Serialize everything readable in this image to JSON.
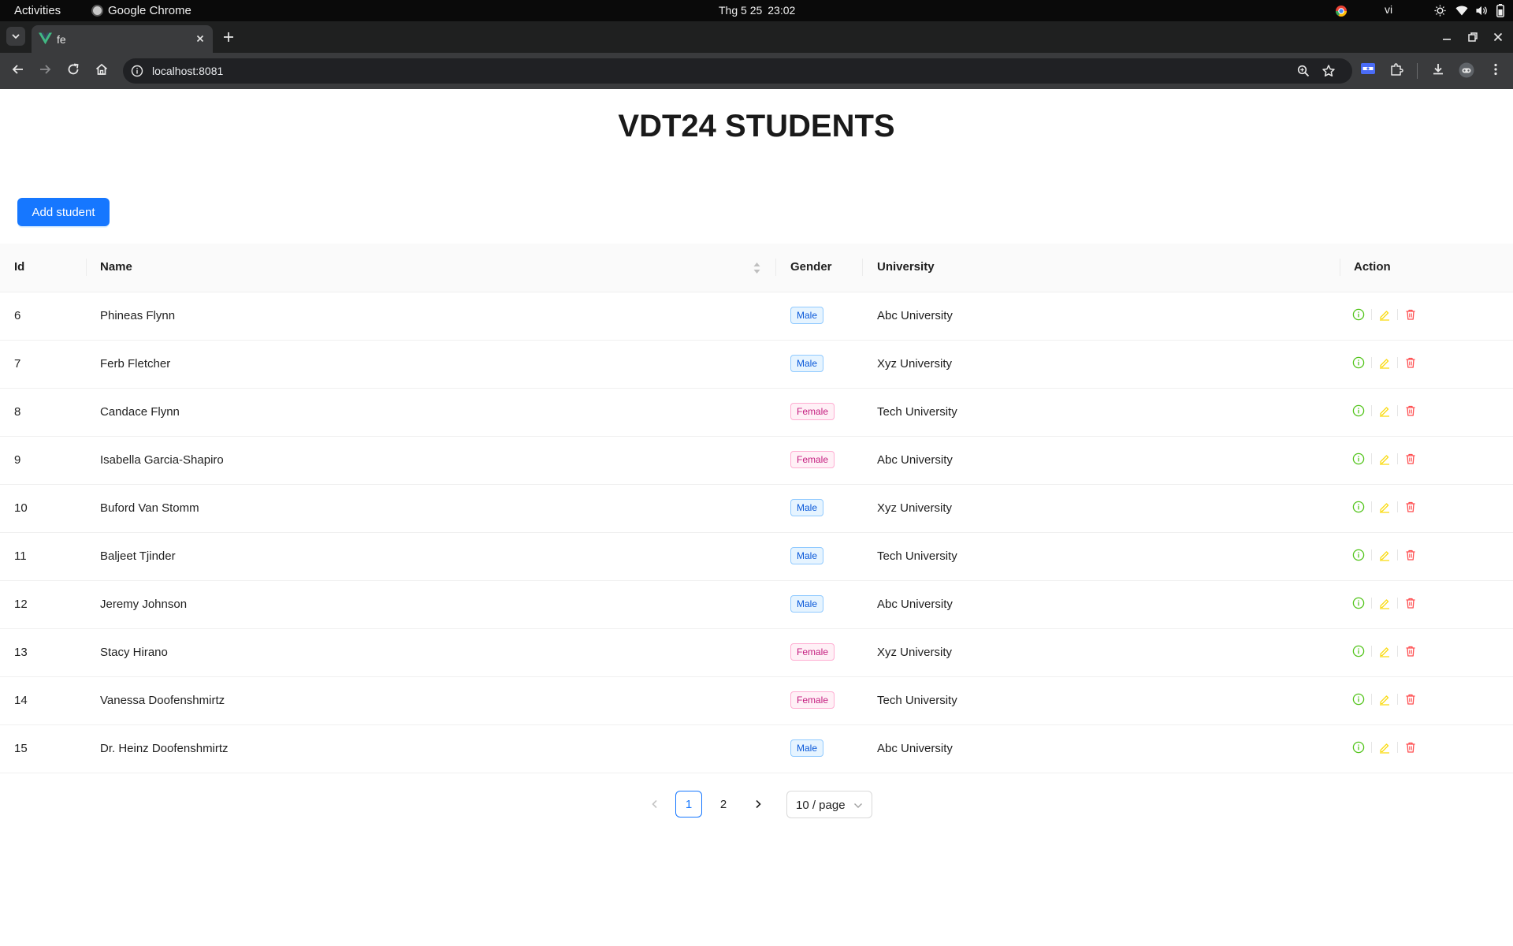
{
  "system_bar": {
    "activities": "Activities",
    "app_name": "Google Chrome",
    "date": "Thg 5 25",
    "time": "23:02",
    "input_lang": "vi"
  },
  "browser": {
    "tab_title": "fe",
    "url": "localhost:8081"
  },
  "page": {
    "title": "VDT24 STUDENTS",
    "add_button": "Add student"
  },
  "table": {
    "columns": [
      "Id",
      "Name",
      "Gender",
      "University",
      "Action"
    ],
    "rows": [
      {
        "id": "6",
        "name": "Phineas Flynn",
        "gender": "Male",
        "university": "Abc University"
      },
      {
        "id": "7",
        "name": "Ferb Fletcher",
        "gender": "Male",
        "university": "Xyz University"
      },
      {
        "id": "8",
        "name": "Candace Flynn",
        "gender": "Female",
        "university": "Tech University"
      },
      {
        "id": "9",
        "name": "Isabella Garcia-Shapiro",
        "gender": "Female",
        "university": "Abc University"
      },
      {
        "id": "10",
        "name": "Buford Van Stomm",
        "gender": "Male",
        "university": "Xyz University"
      },
      {
        "id": "11",
        "name": "Baljeet Tjinder",
        "gender": "Male",
        "university": "Tech University"
      },
      {
        "id": "12",
        "name": "Jeremy Johnson",
        "gender": "Male",
        "university": "Abc University"
      },
      {
        "id": "13",
        "name": "Stacy Hirano",
        "gender": "Female",
        "university": "Xyz University"
      },
      {
        "id": "14",
        "name": "Vanessa Doofenshmirtz",
        "gender": "Female",
        "university": "Tech University"
      },
      {
        "id": "15",
        "name": "Dr. Heinz Doofenshmirtz",
        "gender": "Male",
        "university": "Abc University"
      }
    ]
  },
  "pagination": {
    "pages": [
      "1",
      "2"
    ],
    "current": "1",
    "page_size": "10 / page"
  },
  "icons": {
    "view": "info-circle-icon",
    "edit": "edit-pencil-icon",
    "delete": "trash-icon"
  },
  "colors": {
    "primary": "#1677ff",
    "view": "#52c41a",
    "edit": "#fadb14",
    "delete": "#ff4d4f",
    "male_tag": "#0958d9",
    "female_tag": "#c41d7f"
  }
}
